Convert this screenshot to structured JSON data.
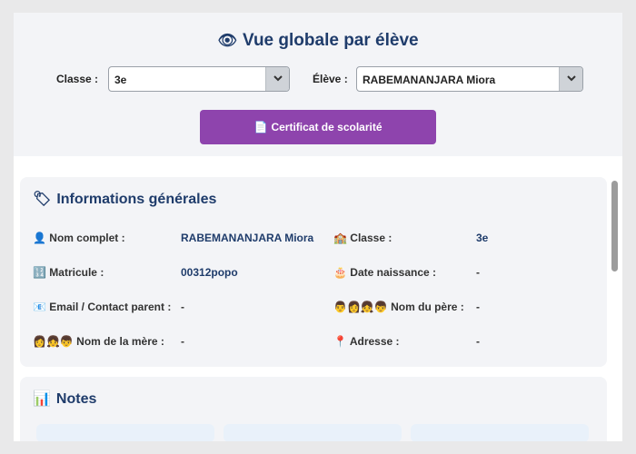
{
  "header": {
    "title_icon": "👁",
    "title": "Vue globale par élève",
    "class_label": "Classe :",
    "class_value": "3e",
    "student_label": "Élève :",
    "student_value": "RABEMANANJARA Miora",
    "certificate_icon": "📄",
    "certificate_label": "Certificat de scolarité",
    "certificate_color": "#8e44ad"
  },
  "info": {
    "title_icon": "🏷",
    "title": "Informations générales",
    "fields": [
      {
        "icon": "👤",
        "label": "Nom complet :",
        "value": "RABEMANANJARA Miora"
      },
      {
        "icon": "🏫",
        "label": "Classe :",
        "value": "3e"
      },
      {
        "icon": "🔢",
        "label": "Matricule :",
        "value": "00312popo"
      },
      {
        "icon": "🎂",
        "label": "Date naissance :",
        "value": "-"
      },
      {
        "icon": "📧",
        "label": "Email / Contact parent :",
        "value": "-"
      },
      {
        "icon": "👨👩👧👦",
        "label": "Nom du père :",
        "value": "-"
      },
      {
        "icon": "👩👧👦",
        "label": "Nom de la mère :",
        "value": "-"
      },
      {
        "icon": "📍",
        "label": "Adresse :",
        "value": "-"
      }
    ]
  },
  "notes": {
    "title_icon": "📊",
    "title": "Notes"
  },
  "colors": {
    "accent": "#1f3c6b",
    "background": "#f3f4f7"
  }
}
